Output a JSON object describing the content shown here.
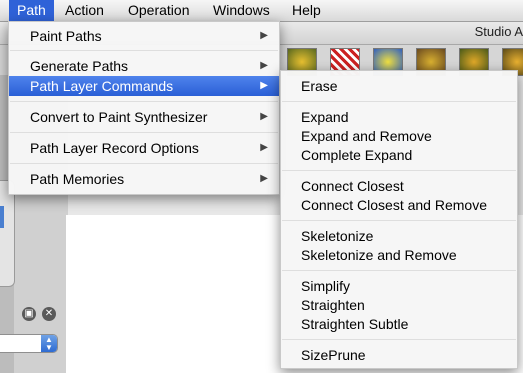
{
  "menubar": {
    "items": [
      "Path",
      "Action",
      "Operation",
      "Windows",
      "Help"
    ],
    "active": "Path"
  },
  "app": {
    "title_fragment": "Studio A"
  },
  "path_menu": {
    "items": [
      "Paint Paths",
      "Generate Paths",
      "Path Layer Commands",
      "Convert to Paint Synthesizer",
      "Path Layer Record Options",
      "Path Memories"
    ],
    "selected": "Path Layer Commands"
  },
  "submenu": {
    "groups": [
      [
        "Erase"
      ],
      [
        "Expand",
        "Expand and Remove",
        "Complete Expand"
      ],
      [
        "Connect Closest",
        "Connect Closest and Remove"
      ],
      [
        "Skeletonize",
        "Skeletonize and Remove"
      ],
      [
        "Simplify",
        "Straighten",
        "Straighten Subtle"
      ],
      [
        "SizePrune"
      ]
    ]
  },
  "icons": {
    "submenu_arrow": "triangle-right-icon",
    "close": "close-icon",
    "restore": "restore-icon"
  },
  "colors": {
    "highlight": "#2f62d8",
    "menu_bg": "#f6f6f6"
  }
}
